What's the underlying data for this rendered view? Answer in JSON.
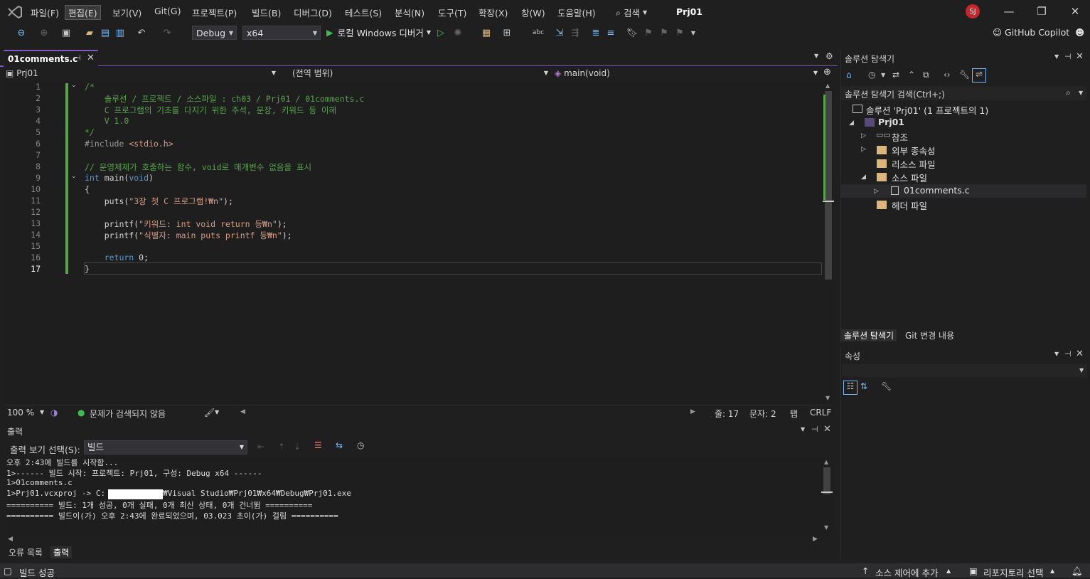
{
  "menu": {
    "items": [
      "파일(F)",
      "편집(E)",
      "보기(V)",
      "Git(G)",
      "프로젝트(P)",
      "빌드(B)",
      "디버그(D)",
      "테스트(S)",
      "분석(N)",
      "도구(T)",
      "확장(X)",
      "창(W)",
      "도움말(H)"
    ],
    "search": "검색",
    "project_title": "Prj01",
    "avatar_initials": "SJ"
  },
  "toolbar": {
    "config": "Debug",
    "platform": "x64",
    "run_label": "로컬 Windows 디버거",
    "copilot_label": "GitHub Copilot"
  },
  "editor": {
    "tab_label": "01comments.c",
    "nav_project": "Prj01",
    "nav_scope": "(전역 범위)",
    "nav_member": "main(void)",
    "line_numbers": [
      "1",
      "2",
      "3",
      "4",
      "5",
      "6",
      "7",
      "8",
      "9",
      "10",
      "11",
      "12",
      "13",
      "14",
      "15",
      "16",
      "17"
    ],
    "lines": {
      "l1": "/*",
      "l2": "    솔루션 / 프로젝트 / 소스파일 : ch03 / Prj01 / 01comments.c",
      "l3": "    C 프로그램의 기초를 다지기 위한 주석, 문장, 키워드 등 이해",
      "l4": "    V 1.0",
      "l5": "*/",
      "l6_pp": "#include ",
      "l6_hdr": "<stdio.h>",
      "l8": "// 운영체제가 호출하는 함수, void로 매개변수 없음을 표시",
      "l9_kw": "int",
      "l9_fn": " main(",
      "l9_kw2": "void",
      "l9_end": ")",
      "l10": "{",
      "l11_a": "    puts(",
      "l11_s": "\"3장 첫 C 프로그램!₩n\"",
      "l11_b": ");",
      "l13_a": "    printf(",
      "l13_s": "\"키워드: int void return 등₩n\"",
      "l13_b": ");",
      "l14_a": "    printf(",
      "l14_s": "\"식별자: main puts printf 등₩n\"",
      "l14_b": ");",
      "l16_kw": "    return",
      "l16_b": " 0;",
      "l17": "}"
    },
    "zoom": "100 %",
    "issues": "문제가 검색되지 않음",
    "line_col": "줄: 17",
    "char_col": "문자: 2",
    "indent": "탭",
    "eol": "CRLF"
  },
  "output": {
    "title": "출력",
    "select_label": "출력 보기 선택(S):",
    "source": "빌드",
    "lines": [
      "오후 2:43에 빌드를 시작함...",
      "1>------ 빌드 시작: 프로젝트: Prj01, 구성: Debug x64 ------",
      "1>01comments.c",
      "1>Prj01.vcxproj -> C:",
      "₩Visual Studio₩Prj01₩x64₩Debug₩Prj01.exe",
      "========== 빌드: 1개 성공, 0개 실패, 0개 최신 상태, 0개 건너뜀 ==========",
      "========== 빌드이(가) 오후 2:43에 완료되었으며, 03.023 초이(가) 걸림 =========="
    ],
    "tabs": [
      "오류 목록",
      "출력"
    ]
  },
  "solution_explorer": {
    "title": "솔루션 탐색기",
    "search_placeholder": "솔루션 탐색기 검색(Ctrl+;)",
    "solution": "솔루션 'Prj01' (1 프로젝트의 1)",
    "project": "Prj01",
    "nodes": [
      "참조",
      "외부 종속성",
      "리소스 파일",
      "소스 파일",
      "01comments.c",
      "헤더 파일"
    ],
    "tabs": [
      "솔루션 탐색기",
      "Git 변경 내용"
    ]
  },
  "properties": {
    "title": "속성"
  },
  "statusbar": {
    "build_status": "빌드 성공",
    "source_control": "소스 제어에 추가",
    "repo": "리포지토리 선택"
  },
  "colors": {
    "accent": "#7e57c2",
    "comment": "#57a64a",
    "keyword": "#569cd6",
    "string": "#d69d85",
    "run_green": "#3fb950",
    "avatar": "#c4282d"
  }
}
